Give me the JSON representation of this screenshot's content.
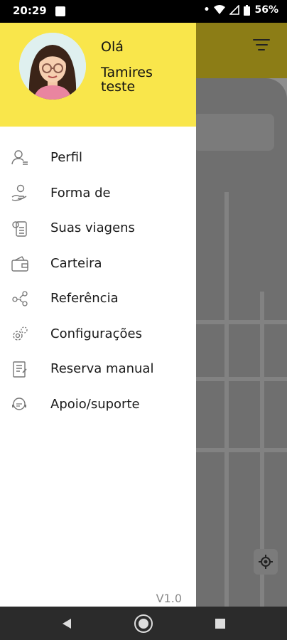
{
  "status_bar": {
    "time": "20:29",
    "battery": "56%"
  },
  "drawer": {
    "greeting": "Olá",
    "user_name": "Tamires teste",
    "menu_items": [
      {
        "label": "Perfil",
        "icon": "profile-icon"
      },
      {
        "label": "Forma de",
        "icon": "payment-hand-icon"
      },
      {
        "label": "Suas viagens",
        "icon": "trips-icon"
      },
      {
        "label": "Carteira",
        "icon": "wallet-icon"
      },
      {
        "label": "Referência",
        "icon": "referral-icon"
      },
      {
        "label": "Configurações",
        "icon": "settings-gear-icon"
      },
      {
        "label": "Reserva manual",
        "icon": "manual-booking-icon"
      },
      {
        "label": "Apoio/suporte",
        "icon": "support-chat-icon"
      }
    ],
    "version": "V1.0"
  },
  "colors": {
    "header_yellow": "#f9e64b",
    "drawer_bg": "#ffffff",
    "nav_bar": "#2b2b2b"
  }
}
